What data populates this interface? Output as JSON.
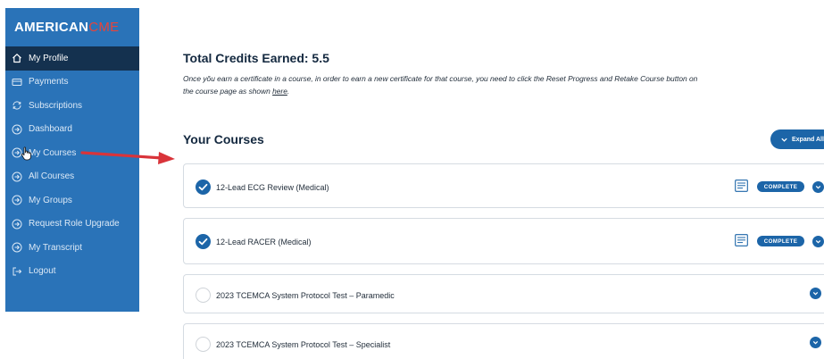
{
  "logo": {
    "part1": "AMERICAN",
    "part2": "CME"
  },
  "sidebar": {
    "items": [
      {
        "label": "My Profile",
        "icon": "home-icon",
        "active": true
      },
      {
        "label": "Payments",
        "icon": "credit-card-icon"
      },
      {
        "label": "Subscriptions",
        "icon": "refresh-icon"
      },
      {
        "label": "Dashboard",
        "icon": "circle-arrow-icon"
      },
      {
        "label": "My Courses",
        "icon": "circle-arrow-icon"
      },
      {
        "label": "All Courses",
        "icon": "circle-arrow-icon"
      },
      {
        "label": "My Groups",
        "icon": "circle-arrow-icon"
      },
      {
        "label": "Request Role Upgrade",
        "icon": "circle-arrow-icon"
      },
      {
        "label": "My Transcript",
        "icon": "circle-arrow-icon"
      },
      {
        "label": "Logout",
        "icon": "logout-icon"
      }
    ]
  },
  "main": {
    "credits_title": "Total Credits Earned: 5.5",
    "notice_line1": "Once yǒu earn a certificate in a course, in order to earn a new certificate for that course, you need to click the Reset Progress and Retake Course button on",
    "notice_line2_prefix": "the course page as shown ",
    "notice_link": "here",
    "notice_line2_suffix": ".",
    "courses_title": "Your Courses",
    "expand_all_label": "Expand All",
    "courses": [
      {
        "title": "12-Lead ECG Review (Medical)",
        "completed": true,
        "badge": "COMPLETE"
      },
      {
        "title": "12-Lead RACER (Medical)",
        "completed": true,
        "badge": "COMPLETE"
      },
      {
        "title": "2023 TCEMCA System Protocol Test – Paramedic",
        "completed": false
      },
      {
        "title": "2023 TCEMCA System Protocol Test – Specialist",
        "completed": false
      }
    ]
  },
  "colors": {
    "sidebar_bg": "#2a73b8",
    "sidebar_active": "#14314f",
    "accent": "#1c65a8",
    "logo_accent": "#e8443a",
    "arrow": "#d9343a"
  }
}
